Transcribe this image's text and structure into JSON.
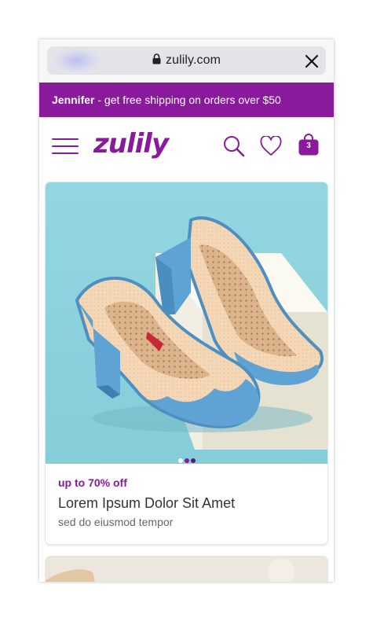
{
  "browser": {
    "url": "zulily.com",
    "lock_icon": "lock-icon",
    "close_icon": "close-icon"
  },
  "promo": {
    "name": "Jennifer",
    "message": " - get free shipping on orders over $50"
  },
  "header": {
    "logo": "zulily",
    "menu_icon": "hamburger-menu-icon",
    "search_icon": "search-icon",
    "wishlist_icon": "heart-icon",
    "cart_icon": "shopping-bag-icon",
    "cart_count": "3"
  },
  "product": {
    "deal": "up to 70% off",
    "title": "Lorem Ipsum Dolor Sit Amet",
    "subtitle": "sed do eiusmod tempor",
    "image_slides": 3,
    "active_slide": 1
  },
  "colors": {
    "brand_purple": "#8a1a9c",
    "image_background": "#8fd3df"
  }
}
